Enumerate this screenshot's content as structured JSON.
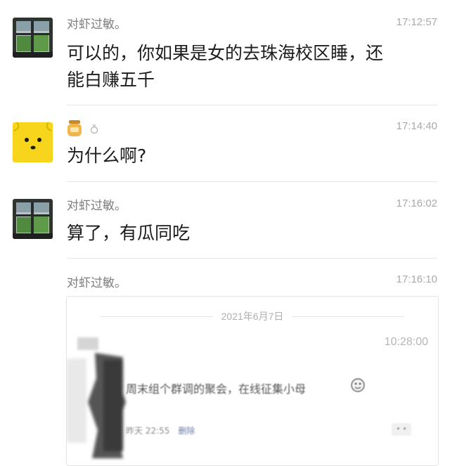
{
  "messages": [
    {
      "sender": "对虾过敏。",
      "time": "17:12:57",
      "text_line1": "可以的，你如果是女的去珠海校区睡，还",
      "text_line2": "能白赚五千"
    },
    {
      "sender_icons": [
        "honey-jar-icon",
        "ring-icon"
      ],
      "time": "17:14:40",
      "text": "为什么啊?"
    },
    {
      "sender": "对虾过敏。",
      "time": "17:16:02",
      "text": "算了，有瓜同吃"
    },
    {
      "sender": "对虾过敏。",
      "time": "17:16:10",
      "forwarded_record": {
        "date": "2021年6月7日",
        "inner_time": "10:28:00",
        "post_text": "周末组个群调的聚会，在线征集小母",
        "post_date": "昨天 22:55",
        "post_delete": "删除",
        "like_label": "•  •"
      }
    }
  ],
  "colors": {
    "sender": "#7d7d7d",
    "time": "#a9a9a9",
    "body": "#1c1c1c",
    "divider": "#e6e6e6",
    "bear_avatar": "#f7d51d"
  }
}
